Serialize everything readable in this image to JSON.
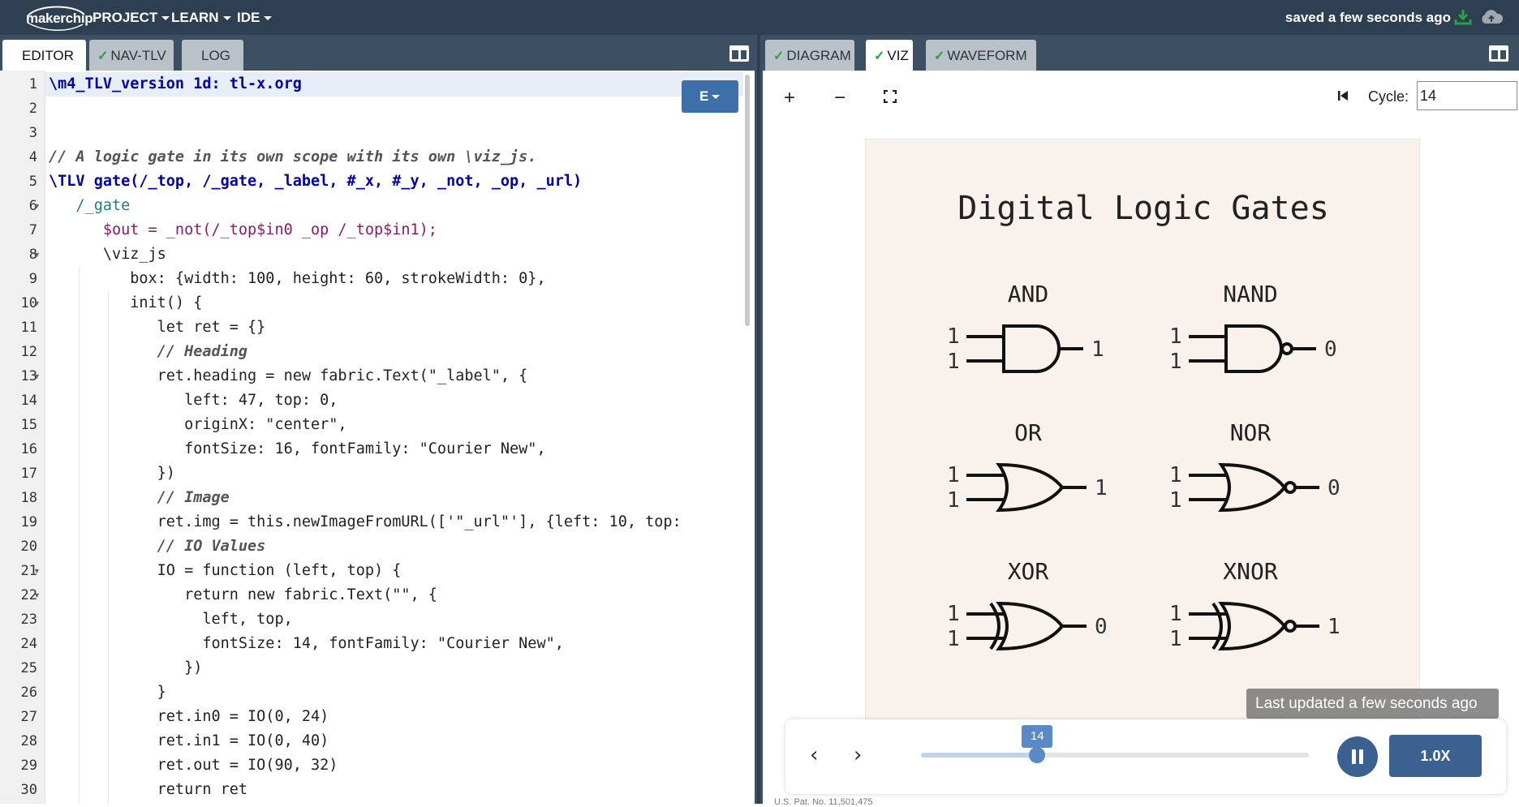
{
  "navbar": {
    "logo": "makerchip",
    "menus": [
      "PROJECT",
      "LEARN",
      "IDE"
    ],
    "saved_status": "saved a few seconds ago"
  },
  "left_tabs": [
    {
      "label": "EDITOR",
      "checked": false,
      "active": true
    },
    {
      "label": "NAV-TLV",
      "checked": true,
      "active": false
    },
    {
      "label": "LOG",
      "checked": false,
      "active": false
    }
  ],
  "right_tabs": [
    {
      "label": "DIAGRAM",
      "checked": true,
      "active": false
    },
    {
      "label": "VIZ",
      "checked": true,
      "active": true
    },
    {
      "label": "WAVEFORM",
      "checked": true,
      "active": false
    }
  ],
  "editor": {
    "e_button": "E",
    "lines": [
      "\\m4_TLV_version 1d: tl-x.org",
      "",
      "",
      "// A logic gate in its own scope with its own \\viz_js.",
      "\\TLV gate(/_top, /_gate, _label, #_x, #_y, _not, _op, _url)",
      "   /_gate",
      "      $out = _not(/_top$in0 _op /_top$in1);",
      "      \\viz_js",
      "         box: {width: 100, height: 60, strokeWidth: 0},",
      "         init() {",
      "            let ret = {}",
      "            // Heading",
      "            ret.heading = new fabric.Text(\"_label\", {",
      "               left: 47, top: 0,",
      "               originX: \"center\",",
      "               fontSize: 16, fontFamily: \"Courier New\",",
      "            })",
      "            // Image",
      "            ret.img = this.newImageFromURL(['\"_url\"'], {left: 10, top:",
      "            // IO Values",
      "            IO = function (left, top) {",
      "               return new fabric.Text(\"\", {",
      "                 left, top,",
      "                 fontSize: 14, fontFamily: \"Courier New\",",
      "               })",
      "            }",
      "            ret.in0 = IO(0, 24)",
      "            ret.in1 = IO(0, 40)",
      "            ret.out = IO(90, 32)",
      "            return ret"
    ]
  },
  "viz": {
    "cycle_label": "Cycle:",
    "cycle_value": "14",
    "canvas_title": "Digital Logic Gates",
    "gates": [
      {
        "label": "AND",
        "in0": "1",
        "in1": "1",
        "out": "1"
      },
      {
        "label": "NAND",
        "in0": "1",
        "in1": "1",
        "out": "0"
      },
      {
        "label": "OR",
        "in0": "1",
        "in1": "1",
        "out": "1"
      },
      {
        "label": "NOR",
        "in0": "1",
        "in1": "1",
        "out": "0"
      },
      {
        "label": "XOR",
        "in0": "1",
        "in1": "1",
        "out": "0"
      },
      {
        "label": "XNOR",
        "in0": "1",
        "in1": "1",
        "out": "1"
      }
    ],
    "tooltip": "Last updated a few seconds ago",
    "slider_value": "14",
    "slider_fraction": 0.3,
    "speed": "1.0X",
    "patent": "U.S. Pat. No. 11,501,475"
  },
  "colors": {
    "navbar": "#2e3f52",
    "tabbar": "#3c4f63",
    "accent": "#3d6fa8",
    "check": "#2aa144",
    "canvas": "#f9f2ec"
  }
}
